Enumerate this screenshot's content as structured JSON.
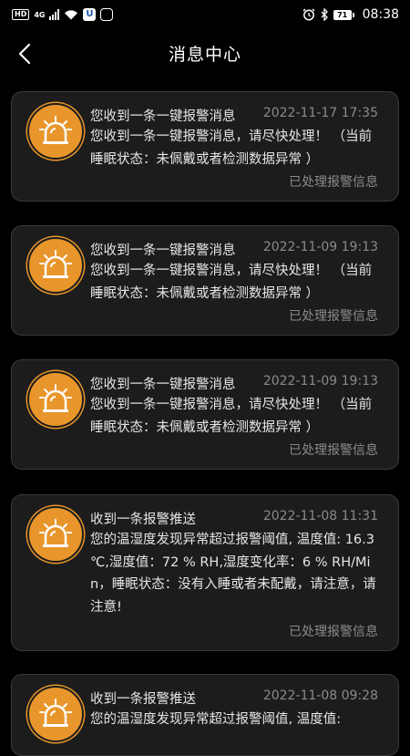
{
  "status_bar": {
    "network_tag": "HD",
    "signal_label": "4G",
    "time": "08:38",
    "battery": "71"
  },
  "header": {
    "title": "消息中心"
  },
  "messages": [
    {
      "title": "您收到一条一键报警消息",
      "time": "2022-11-17 17:35",
      "body": "您收到一条一键报警消息，请尽快处理！ （当前睡眠状态：未佩戴或者检测数据异常 ）",
      "status": "已处理报警信息"
    },
    {
      "title": "您收到一条一键报警消息",
      "time": "2022-11-09 19:13",
      "body": "您收到一条一键报警消息，请尽快处理！ （当前睡眠状态：未佩戴或者检测数据异常 ）",
      "status": "已处理报警信息"
    },
    {
      "title": "您收到一条一键报警消息",
      "time": "2022-11-09 19:13",
      "body": "您收到一条一键报警消息，请尽快处理！ （当前睡眠状态：未佩戴或者检测数据异常 ）",
      "status": "已处理报警信息"
    },
    {
      "title": "收到一条报警推送",
      "time": "2022-11-08 11:31",
      "body": "您的温湿度发现异常超过报警阈值, 温度值: 16.3 ℃,湿度值：72 % RH,湿度变化率：6 % RH/Min，睡眠状态：没有入睡或者未配戴，请注意，请注意!",
      "status": "已处理报警信息"
    },
    {
      "title": "收到一条报警推送",
      "time": "2022-11-08 09:28",
      "body": "您的温湿度发现异常超过报警阈值, 温度值:",
      "status": ""
    }
  ],
  "colors": {
    "alarm_orange": "#e8962b",
    "card_bg": "#1c1c1c",
    "muted_text": "#8a8a8a"
  }
}
